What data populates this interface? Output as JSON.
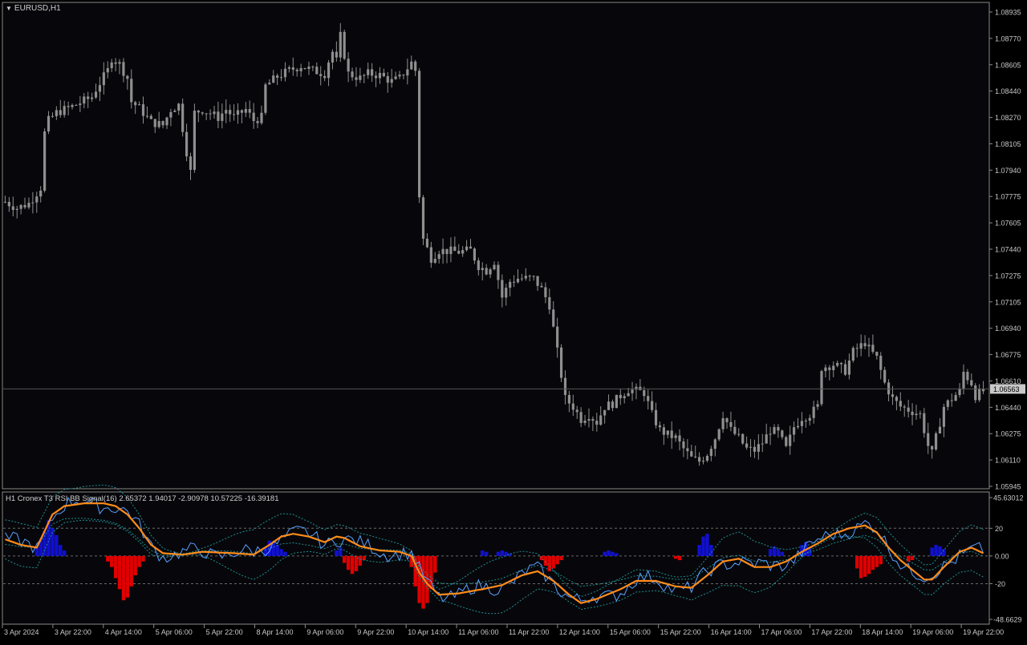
{
  "window": {
    "title": "EURUSD,H1"
  },
  "price_axis": {
    "labels": [
      "1.08935",
      "1.08770",
      "1.08605",
      "1.08440",
      "1.08270",
      "1.08105",
      "1.07940",
      "1.07775",
      "1.07605",
      "1.07440",
      "1.07275",
      "1.07105",
      "1.06940",
      "1.06775",
      "1.06610",
      "1.06440",
      "1.06275",
      "1.06110",
      "1.05945"
    ],
    "current_price": "1.06563"
  },
  "indicator": {
    "title": "H1  Cronex T3 RSI BB Signal(16) 2.65372 1.94017 -2.90978 10.57225 -16.39181",
    "axis_labels": [
      "45.63012",
      "20",
      "0.00",
      "-20",
      "-48.6629"
    ]
  },
  "time_axis": {
    "labels": [
      "3 Apr 2024",
      "3 Apr 22:00",
      "4 Apr 14:00",
      "5 Apr 06:00",
      "5 Apr 22:00",
      "8 Apr 14:00",
      "9 Apr 06:00",
      "9 Apr 22:00",
      "10 Apr 14:00",
      "11 Apr 06:00",
      "11 Apr 22:00",
      "12 Apr 14:00",
      "15 Apr 06:00",
      "15 Apr 22:00",
      "16 Apr 14:00",
      "17 Apr 06:00",
      "17 Apr 22:00",
      "18 Apr 14:00",
      "19 Apr 06:00",
      "19 Apr 22:00"
    ]
  },
  "colors": {
    "background": "#000000",
    "chart_bg": "#07070b",
    "grid_border": "#8a8a8a",
    "candle": "#8f8f8f",
    "text": "#c8c8c8",
    "price_marker_bg": "#c8c8c8",
    "t3_line": "#ff8c1a",
    "rsi_line": "#5aa0ff",
    "band_line": "#1f8f8f",
    "hist_up": "#1010d0",
    "hist_down": "#e00000"
  },
  "chart_data": {
    "type": "candlestick",
    "ylim": [
      1.0594,
      1.0902
    ],
    "close_waypoints": [
      [
        0,
        1.0776
      ],
      [
        3,
        1.0772
      ],
      [
        6,
        1.0775
      ],
      [
        9,
        1.0785
      ],
      [
        10,
        1.082
      ],
      [
        11,
        1.0828
      ],
      [
        13,
        1.0833
      ],
      [
        17,
        1.0837
      ],
      [
        22,
        1.0843
      ],
      [
        23,
        1.0848
      ],
      [
        26,
        1.086
      ],
      [
        27,
        1.0868
      ],
      [
        29,
        1.0864
      ],
      [
        31,
        1.0855
      ],
      [
        32,
        1.084
      ],
      [
        34,
        1.0836
      ],
      [
        37,
        1.0827
      ],
      [
        40,
        1.0825
      ],
      [
        42,
        1.0835
      ],
      [
        44,
        1.0838
      ],
      [
        46,
        1.0808
      ],
      [
        47,
        1.0795
      ],
      [
        48,
        1.0833
      ],
      [
        50,
        1.0835
      ],
      [
        54,
        1.083
      ],
      [
        56,
        1.0835
      ],
      [
        58,
        1.083
      ],
      [
        61,
        1.0835
      ],
      [
        63,
        1.0828
      ],
      [
        65,
        1.083
      ],
      [
        66,
        1.085
      ],
      [
        69,
        1.0856
      ],
      [
        72,
        1.086
      ],
      [
        75,
        1.0863
      ],
      [
        78,
        1.086
      ],
      [
        81,
        1.0858
      ],
      [
        82,
        1.0866
      ],
      [
        83,
        1.0872
      ],
      [
        84,
        1.0866
      ],
      [
        85,
        1.0882
      ],
      [
        86,
        1.087
      ],
      [
        87,
        1.0858
      ],
      [
        90,
        1.0855
      ],
      [
        92,
        1.0858
      ],
      [
        95,
        1.0857
      ],
      [
        98,
        1.0853
      ],
      [
        100,
        1.0855
      ],
      [
        103,
        1.0865
      ],
      [
        104,
        1.086
      ],
      [
        105,
        1.078
      ],
      [
        106,
        1.0752
      ],
      [
        108,
        1.074
      ],
      [
        110,
        1.0745
      ],
      [
        115,
        1.0744
      ],
      [
        118,
        1.0745
      ],
      [
        120,
        1.0735
      ],
      [
        122,
        1.0732
      ],
      [
        124,
        1.0738
      ],
      [
        126,
        1.0715
      ],
      [
        128,
        1.0725
      ],
      [
        130,
        1.0727
      ],
      [
        134,
        1.0727
      ],
      [
        136,
        1.072
      ],
      [
        138,
        1.071
      ],
      [
        140,
        1.068
      ],
      [
        142,
        1.065
      ],
      [
        144,
        1.0645
      ],
      [
        146,
        1.0637
      ],
      [
        148,
        1.064
      ],
      [
        150,
        1.0635
      ],
      [
        152,
        1.0645
      ],
      [
        154,
        1.0647
      ],
      [
        156,
        1.0652
      ],
      [
        158,
        1.0656
      ],
      [
        162,
        1.0654
      ],
      [
        164,
        1.064
      ],
      [
        166,
        1.063
      ],
      [
        168,
        1.0627
      ],
      [
        170,
        1.0625
      ],
      [
        172,
        1.0618
      ],
      [
        174,
        1.0612
      ],
      [
        176,
        1.061
      ],
      [
        178,
        1.0615
      ],
      [
        180,
        1.0625
      ],
      [
        182,
        1.064
      ],
      [
        184,
        1.063
      ],
      [
        186,
        1.0625
      ],
      [
        188,
        1.0618
      ],
      [
        190,
        1.0617
      ],
      [
        192,
        1.0622
      ],
      [
        194,
        1.063
      ],
      [
        196,
        1.0628
      ],
      [
        198,
        1.0618
      ],
      [
        200,
        1.0632
      ],
      [
        202,
        1.0638
      ],
      [
        204,
        1.064
      ],
      [
        206,
        1.0645
      ],
      [
        207,
        1.067
      ],
      [
        210,
        1.0672
      ],
      [
        213,
        1.0668
      ],
      [
        215,
        1.068
      ],
      [
        218,
        1.0686
      ],
      [
        219,
        1.0682
      ],
      [
        221,
        1.0676
      ],
      [
        223,
        1.066
      ],
      [
        225,
        1.065
      ],
      [
        227,
        1.0645
      ],
      [
        230,
        1.0642
      ],
      [
        232,
        1.064
      ],
      [
        234,
        1.062
      ],
      [
        235,
        1.0615
      ],
      [
        237,
        1.0635
      ],
      [
        238,
        1.0645
      ],
      [
        240,
        1.065
      ],
      [
        242,
        1.0655
      ],
      [
        243,
        1.0667
      ],
      [
        245,
        1.066
      ],
      [
        246,
        1.0652
      ],
      [
        248,
        1.0655
      ]
    ],
    "candle_count": 249,
    "current_price": 1.06563
  },
  "indicator_data": {
    "ylim": [
      -48.6629,
      45.63012
    ],
    "levels": [
      20,
      0,
      -20
    ],
    "t3_waypoints": [
      [
        0,
        12
      ],
      [
        4,
        8
      ],
      [
        8,
        6
      ],
      [
        10,
        18
      ],
      [
        12,
        30
      ],
      [
        15,
        36
      ],
      [
        20,
        38
      ],
      [
        25,
        38
      ],
      [
        28,
        36
      ],
      [
        31,
        30
      ],
      [
        34,
        20
      ],
      [
        37,
        8
      ],
      [
        40,
        2
      ],
      [
        45,
        1
      ],
      [
        50,
        3
      ],
      [
        58,
        2
      ],
      [
        63,
        1
      ],
      [
        67,
        8
      ],
      [
        70,
        14
      ],
      [
        73,
        16
      ],
      [
        77,
        14
      ],
      [
        81,
        10
      ],
      [
        84,
        14
      ],
      [
        86,
        13
      ],
      [
        90,
        7
      ],
      [
        95,
        4
      ],
      [
        100,
        3
      ],
      [
        103,
        0
      ],
      [
        105,
        -12
      ],
      [
        107,
        -20
      ],
      [
        110,
        -28
      ],
      [
        115,
        -27
      ],
      [
        121,
        -24
      ],
      [
        126,
        -21
      ],
      [
        131,
        -14
      ],
      [
        135,
        -11
      ],
      [
        139,
        -18
      ],
      [
        143,
        -28
      ],
      [
        146,
        -34
      ],
      [
        150,
        -31
      ],
      [
        156,
        -24
      ],
      [
        160,
        -18
      ],
      [
        165,
        -18
      ],
      [
        170,
        -22
      ],
      [
        174,
        -23
      ],
      [
        178,
        -14
      ],
      [
        182,
        -4
      ],
      [
        186,
        -2
      ],
      [
        190,
        -8
      ],
      [
        194,
        -8
      ],
      [
        198,
        -4
      ],
      [
        202,
        3
      ],
      [
        206,
        9
      ],
      [
        210,
        16
      ],
      [
        214,
        20
      ],
      [
        218,
        22
      ],
      [
        221,
        17
      ],
      [
        224,
        6
      ],
      [
        227,
        -3
      ],
      [
        230,
        -10
      ],
      [
        233,
        -17
      ],
      [
        235,
        -17
      ],
      [
        238,
        -8
      ],
      [
        242,
        3
      ],
      [
        245,
        6
      ],
      [
        248,
        2
      ]
    ],
    "hist": [
      [
        8,
        6
      ],
      [
        9,
        12
      ],
      [
        10,
        18
      ],
      [
        11,
        26
      ],
      [
        12,
        20
      ],
      [
        13,
        15
      ],
      [
        14,
        8
      ],
      [
        15,
        4
      ],
      [
        26,
        -4
      ],
      [
        27,
        -8
      ],
      [
        28,
        -16
      ],
      [
        29,
        -24
      ],
      [
        30,
        -32
      ],
      [
        31,
        -30
      ],
      [
        32,
        -22
      ],
      [
        33,
        -14
      ],
      [
        34,
        -8
      ],
      [
        35,
        -4
      ],
      [
        66,
        6
      ],
      [
        67,
        11
      ],
      [
        68,
        10
      ],
      [
        69,
        8
      ],
      [
        70,
        5
      ],
      [
        71,
        3
      ],
      [
        84,
        4
      ],
      [
        85,
        6
      ],
      [
        86,
        -5
      ],
      [
        87,
        -10
      ],
      [
        88,
        -13
      ],
      [
        89,
        -11
      ],
      [
        90,
        -7
      ],
      [
        91,
        -3
      ],
      [
        103,
        -8
      ],
      [
        104,
        -22
      ],
      [
        105,
        -34
      ],
      [
        106,
        -38
      ],
      [
        107,
        -34
      ],
      [
        108,
        -24
      ],
      [
        109,
        -12
      ],
      [
        121,
        4
      ],
      [
        122,
        3
      ],
      [
        125,
        3
      ],
      [
        126,
        4
      ],
      [
        127,
        3
      ],
      [
        128,
        2
      ],
      [
        136,
        -3
      ],
      [
        137,
        -7
      ],
      [
        138,
        -11
      ],
      [
        139,
        -9
      ],
      [
        140,
        -6
      ],
      [
        141,
        -3
      ],
      [
        152,
        3
      ],
      [
        153,
        4
      ],
      [
        154,
        3
      ],
      [
        155,
        2
      ],
      [
        170,
        -2
      ],
      [
        171,
        -3
      ],
      [
        176,
        8
      ],
      [
        177,
        14
      ],
      [
        178,
        16
      ],
      [
        179,
        8
      ],
      [
        194,
        5
      ],
      [
        195,
        7
      ],
      [
        196,
        5
      ],
      [
        197,
        3
      ],
      [
        202,
        8
      ],
      [
        203,
        10
      ],
      [
        204,
        6
      ],
      [
        216,
        -9
      ],
      [
        217,
        -16
      ],
      [
        218,
        -15
      ],
      [
        219,
        -13
      ],
      [
        220,
        -10
      ],
      [
        221,
        -8
      ],
      [
        222,
        -6
      ],
      [
        229,
        -4
      ],
      [
        230,
        -3
      ],
      [
        235,
        6
      ],
      [
        236,
        8
      ],
      [
        237,
        7
      ],
      [
        238,
        5
      ]
    ]
  }
}
